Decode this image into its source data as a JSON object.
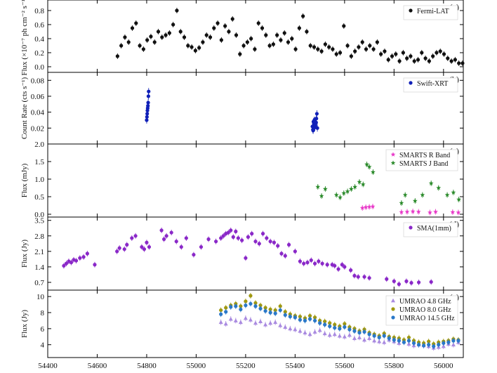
{
  "chart_data": [
    {
      "type": "scatter",
      "panel_label": "(a)",
      "ylabel": "Flux (×10⁻⁷ ph cm⁻² s⁻¹)",
      "ylim": [
        -0.08,
        0.95
      ],
      "yticks": [
        "0.0",
        "0.2",
        "0.4",
        "0.6",
        "0.8"
      ],
      "ytick_values": [
        0.0,
        0.2,
        0.4,
        0.6,
        0.8
      ],
      "legend_position": "top-right",
      "series": [
        {
          "name": "Fermi-LAT",
          "marker": "circle",
          "color": "#111111",
          "x": [
            54682,
            54697,
            54712,
            54727,
            54742,
            54757,
            54772,
            54787,
            54802,
            54817,
            54832,
            54847,
            54862,
            54877,
            54892,
            54907,
            54922,
            54937,
            54952,
            54967,
            54982,
            54997,
            55012,
            55027,
            55042,
            55057,
            55072,
            55087,
            55102,
            55117,
            55132,
            55147,
            55162,
            55177,
            55192,
            55207,
            55222,
            55237,
            55252,
            55267,
            55282,
            55297,
            55312,
            55327,
            55342,
            55357,
            55372,
            55387,
            55402,
            55417,
            55432,
            55447,
            55462,
            55477,
            55492,
            55507,
            55522,
            55537,
            55552,
            55567,
            55582,
            55597,
            55612,
            55627,
            55642,
            55657,
            55672,
            55687,
            55702,
            55717,
            55732,
            55747,
            55762,
            55777,
            55792,
            55807,
            55822,
            55837,
            55852,
            55867,
            55882,
            55897,
            55912,
            55927,
            55942,
            55957,
            55972,
            55987,
            56002,
            56017,
            56032,
            56047,
            56062,
            56077
          ],
          "y": [
            0.15,
            0.3,
            0.42,
            0.35,
            0.55,
            0.62,
            0.3,
            0.25,
            0.38,
            0.43,
            0.35,
            0.5,
            0.42,
            0.45,
            0.48,
            0.6,
            0.8,
            0.5,
            0.42,
            0.3,
            0.28,
            0.23,
            0.27,
            0.35,
            0.45,
            0.42,
            0.55,
            0.62,
            0.38,
            0.58,
            0.5,
            0.68,
            0.45,
            0.18,
            0.3,
            0.35,
            0.4,
            0.25,
            0.62,
            0.55,
            0.45,
            0.3,
            0.32,
            0.45,
            0.38,
            0.48,
            0.35,
            0.4,
            0.25,
            0.55,
            0.72,
            0.5,
            0.3,
            0.28,
            0.25,
            0.22,
            0.32,
            0.28,
            0.25,
            0.18,
            0.2,
            0.58,
            0.3,
            0.15,
            0.22,
            0.28,
            0.35,
            0.25,
            0.3,
            0.25,
            0.35,
            0.18,
            0.22,
            0.1,
            0.15,
            0.18,
            0.08,
            0.2,
            0.12,
            0.15,
            0.08,
            0.1,
            0.2,
            0.12,
            0.08,
            0.15,
            0.2,
            0.22,
            0.18,
            0.12,
            0.08,
            0.1,
            0.05,
            0.05
          ]
        }
      ]
    },
    {
      "type": "scatter",
      "panel_label": "(b)",
      "ylabel": "Count Rate (cts s⁻¹)",
      "ylim": [
        0.0,
        0.09
      ],
      "yticks": [
        "0.02",
        "0.04",
        "0.06",
        "0.08"
      ],
      "ytick_values": [
        0.02,
        0.04,
        0.06,
        0.08
      ],
      "legend_position": "top-right",
      "series": [
        {
          "name": "Swift-XRT",
          "marker": "circle",
          "color": "#1020b8",
          "x": [
            54800,
            54801,
            54802,
            54803,
            54804,
            54805,
            54806,
            54807,
            54808,
            55470,
            55472,
            55474,
            55476,
            55478,
            55480,
            55482,
            55484,
            55486,
            55488,
            55490,
            55473,
            55477,
            55481,
            55485
          ],
          "y": [
            0.03,
            0.034,
            0.038,
            0.042,
            0.045,
            0.048,
            0.052,
            0.06,
            0.066,
            0.022,
            0.018,
            0.028,
            0.025,
            0.03,
            0.021,
            0.023,
            0.026,
            0.032,
            0.038,
            0.02,
            0.017,
            0.029,
            0.024,
            0.027
          ]
        }
      ]
    },
    {
      "type": "scatter",
      "panel_label": "(c)",
      "ylabel": "Flux (mJy)",
      "ylim": [
        -0.08,
        2.0
      ],
      "yticks": [
        "0.0",
        "0.5",
        "1.0",
        "1.5",
        "2.0"
      ],
      "ytick_values": [
        0.0,
        0.5,
        1.0,
        1.5,
        2.0
      ],
      "legend_position": "top-right",
      "series": [
        {
          "name": "SMARTS R Band",
          "marker": "star",
          "color": "#e838c8",
          "x": [
            55672,
            55686,
            55700,
            55714,
            55830,
            55853,
            55876,
            55899,
            55945,
            55968,
            56037,
            56060
          ],
          "y": [
            0.18,
            0.2,
            0.21,
            0.22,
            0.06,
            0.07,
            0.08,
            0.07,
            0.05,
            0.07,
            0.06,
            0.05
          ]
        },
        {
          "name": "SMARTS  J Band",
          "marker": "star",
          "color": "#2a8a2a",
          "x": [
            55492,
            55507,
            55522,
            55567,
            55582,
            55597,
            55612,
            55627,
            55642,
            55660,
            55675,
            55690,
            55700,
            55715,
            55830,
            55845,
            55885,
            55915,
            55950,
            55980,
            56015,
            56040,
            56062
          ],
          "y": [
            0.78,
            0.52,
            0.72,
            0.55,
            0.48,
            0.6,
            0.65,
            0.72,
            0.78,
            0.92,
            0.85,
            1.42,
            1.35,
            1.2,
            0.32,
            0.55,
            0.38,
            0.55,
            0.88,
            0.75,
            0.55,
            0.62,
            0.42
          ]
        }
      ]
    },
    {
      "type": "scatter",
      "panel_label": "(d)",
      "ylabel": "Flux (Jy)",
      "ylim": [
        0.35,
        3.65
      ],
      "yticks": [
        "0.7",
        "1.4",
        "2.1",
        "2.8",
        "3.5"
      ],
      "ytick_values": [
        0.7,
        1.4,
        2.1,
        2.8,
        3.5
      ],
      "legend_position": "top-right",
      "series": [
        {
          "name": "SMA(1mm)",
          "marker": "circle",
          "color": "#8a28c8",
          "x": [
            54465,
            54475,
            54485,
            54495,
            54505,
            54515,
            54530,
            54545,
            54560,
            54590,
            54680,
            54690,
            54710,
            54720,
            54740,
            54755,
            54780,
            54790,
            54800,
            54810,
            54860,
            54870,
            54880,
            54900,
            54920,
            54940,
            54960,
            54990,
            55020,
            55050,
            55080,
            55100,
            55110,
            55120,
            55130,
            55140,
            55150,
            55160,
            55170,
            55185,
            55200,
            55210,
            55225,
            55240,
            55255,
            55270,
            55285,
            55300,
            55315,
            55330,
            55345,
            55360,
            55375,
            55400,
            55420,
            55435,
            55450,
            55465,
            55480,
            55495,
            55510,
            55530,
            55550,
            55560,
            55575,
            55590,
            55600,
            55625,
            55640,
            55655,
            55680,
            55700,
            55770,
            55800,
            55820,
            55850,
            55870,
            55900,
            55950
          ],
          "y": [
            1.45,
            1.55,
            1.65,
            1.6,
            1.72,
            1.68,
            1.8,
            1.85,
            2.0,
            1.5,
            2.1,
            2.25,
            2.2,
            2.4,
            2.7,
            2.8,
            2.3,
            2.2,
            2.5,
            2.3,
            3.05,
            2.65,
            2.8,
            2.95,
            2.55,
            2.3,
            2.7,
            1.95,
            2.3,
            2.65,
            2.55,
            2.7,
            2.8,
            2.9,
            2.95,
            3.05,
            2.75,
            3.0,
            2.7,
            2.6,
            1.8,
            2.75,
            2.9,
            2.55,
            2.45,
            2.9,
            2.7,
            2.55,
            2.5,
            2.35,
            2.0,
            1.9,
            2.4,
            2.1,
            1.65,
            1.55,
            1.6,
            1.7,
            1.55,
            1.65,
            1.55,
            1.5,
            1.5,
            1.45,
            1.3,
            1.5,
            1.4,
            1.25,
            1.0,
            0.95,
            0.95,
            0.9,
            0.85,
            0.75,
            0.62,
            0.75,
            0.68,
            0.7,
            0.72
          ]
        }
      ]
    },
    {
      "type": "scatter",
      "panel_label": "(e)",
      "ylabel": "Flux (Jy)",
      "ylim": [
        2.4,
        10.8
      ],
      "yticks": [
        "4",
        "6",
        "8",
        "10"
      ],
      "ytick_values": [
        4,
        6,
        8,
        10
      ],
      "legend_position": "top-right",
      "x_shared": [
        55100,
        55120,
        55140,
        55160,
        55180,
        55200,
        55220,
        55240,
        55260,
        55280,
        55300,
        55320,
        55340,
        55360,
        55380,
        55400,
        55420,
        55440,
        55460,
        55480,
        55500,
        55520,
        55540,
        55560,
        55580,
        55600,
        55620,
        55640,
        55660,
        55680,
        55700,
        55720,
        55740,
        55760,
        55780,
        55800,
        55820,
        55840,
        55860,
        55880,
        55900,
        55920,
        55940,
        55960,
        55980,
        56000,
        56020,
        56040,
        56060
      ],
      "series": [
        {
          "name": "UMRAO 4.8 GHz",
          "marker": "triangle",
          "color": "#a98ae0",
          "x": [
            55100,
            55120,
            55140,
            55160,
            55180,
            55200,
            55220,
            55240,
            55260,
            55280,
            55300,
            55320,
            55340,
            55360,
            55380,
            55400,
            55420,
            55440,
            55460,
            55480,
            55500,
            55520,
            55540,
            55560,
            55580,
            55600,
            55620,
            55640,
            55660,
            55680,
            55700,
            55720,
            55740,
            55760,
            55780,
            55800,
            55820,
            55840,
            55860,
            55880,
            55900,
            55920,
            55940,
            55960,
            55980,
            56000,
            56020,
            56040,
            56060
          ],
          "y": [
            6.8,
            6.6,
            7.2,
            7.0,
            6.8,
            7.3,
            7.1,
            6.7,
            6.9,
            6.5,
            6.7,
            6.8,
            6.4,
            6.2,
            6.0,
            5.9,
            5.7,
            5.5,
            5.3,
            5.6,
            5.8,
            5.4,
            5.2,
            5.3,
            5.1,
            5.0,
            5.2,
            4.8,
            4.9,
            4.6,
            4.8,
            4.5,
            4.4,
            4.3,
            4.6,
            4.4,
            4.2,
            4.4,
            4.1,
            3.9,
            4.0,
            3.9,
            3.8,
            3.6,
            3.7,
            3.8,
            4.1,
            4.0,
            4.3
          ]
        },
        {
          "name": "UMRAO 8.0 GHz",
          "marker": "circle",
          "color": "#a09810",
          "x": [
            55100,
            55120,
            55140,
            55160,
            55180,
            55200,
            55220,
            55240,
            55260,
            55280,
            55300,
            55320,
            55340,
            55360,
            55380,
            55400,
            55420,
            55440,
            55460,
            55480,
            55500,
            55520,
            55540,
            55560,
            55580,
            55600,
            55620,
            55640,
            55660,
            55680,
            55700,
            55720,
            55740,
            55760,
            55780,
            55800,
            55820,
            55840,
            55860,
            55880,
            55900,
            55920,
            55940,
            55960,
            55980,
            56000,
            56020,
            56040,
            56060
          ],
          "y": [
            8.3,
            8.6,
            8.9,
            9.1,
            8.8,
            9.4,
            10.1,
            9.2,
            8.9,
            8.6,
            8.4,
            8.3,
            8.8,
            8.1,
            7.8,
            7.6,
            7.5,
            7.3,
            7.6,
            7.4,
            7.0,
            6.9,
            6.7,
            6.5,
            6.3,
            6.6,
            6.2,
            6.0,
            5.7,
            5.9,
            5.5,
            5.3,
            5.1,
            5.4,
            5.0,
            4.9,
            4.8,
            4.6,
            4.9,
            4.5,
            4.3,
            4.2,
            4.4,
            4.1,
            4.3,
            4.4,
            4.5,
            4.7,
            4.6
          ]
        },
        {
          "name": "UMRAO 14.5 GHz",
          "marker": "circle",
          "color": "#2a78c8",
          "x": [
            55100,
            55120,
            55140,
            55160,
            55180,
            55200,
            55220,
            55240,
            55260,
            55280,
            55300,
            55320,
            55340,
            55360,
            55380,
            55400,
            55420,
            55440,
            55460,
            55480,
            55500,
            55520,
            55540,
            55560,
            55580,
            55600,
            55620,
            55640,
            55660,
            55680,
            55700,
            55720,
            55740,
            55760,
            55780,
            55800,
            55820,
            55840,
            55860,
            55880,
            55900,
            55920,
            55940,
            55960,
            55980,
            56000,
            56020,
            56040,
            56060
          ],
          "y": [
            7.8,
            8.1,
            8.7,
            8.8,
            8.4,
            8.9,
            9.1,
            8.8,
            8.5,
            8.2,
            8.0,
            7.9,
            8.3,
            7.7,
            7.5,
            7.4,
            7.1,
            7.0,
            7.2,
            7.0,
            6.7,
            6.5,
            6.3,
            6.1,
            6.0,
            6.2,
            5.9,
            5.7,
            5.5,
            5.6,
            5.3,
            5.1,
            4.9,
            5.1,
            4.8,
            4.6,
            4.5,
            4.3,
            4.5,
            4.2,
            4.0,
            3.9,
            4.0,
            3.8,
            4.0,
            4.2,
            4.3,
            4.5,
            4.5
          ]
        }
      ]
    }
  ],
  "x_axis": {
    "ticks": [
      "54400",
      "54600",
      "54800",
      "55000",
      "55200",
      "55400",
      "55600",
      "55800",
      "56000"
    ],
    "tick_values": [
      54400,
      54600,
      54800,
      55000,
      55200,
      55400,
      55600,
      55800,
      56000
    ],
    "xlim": [
      54400,
      56080
    ]
  }
}
